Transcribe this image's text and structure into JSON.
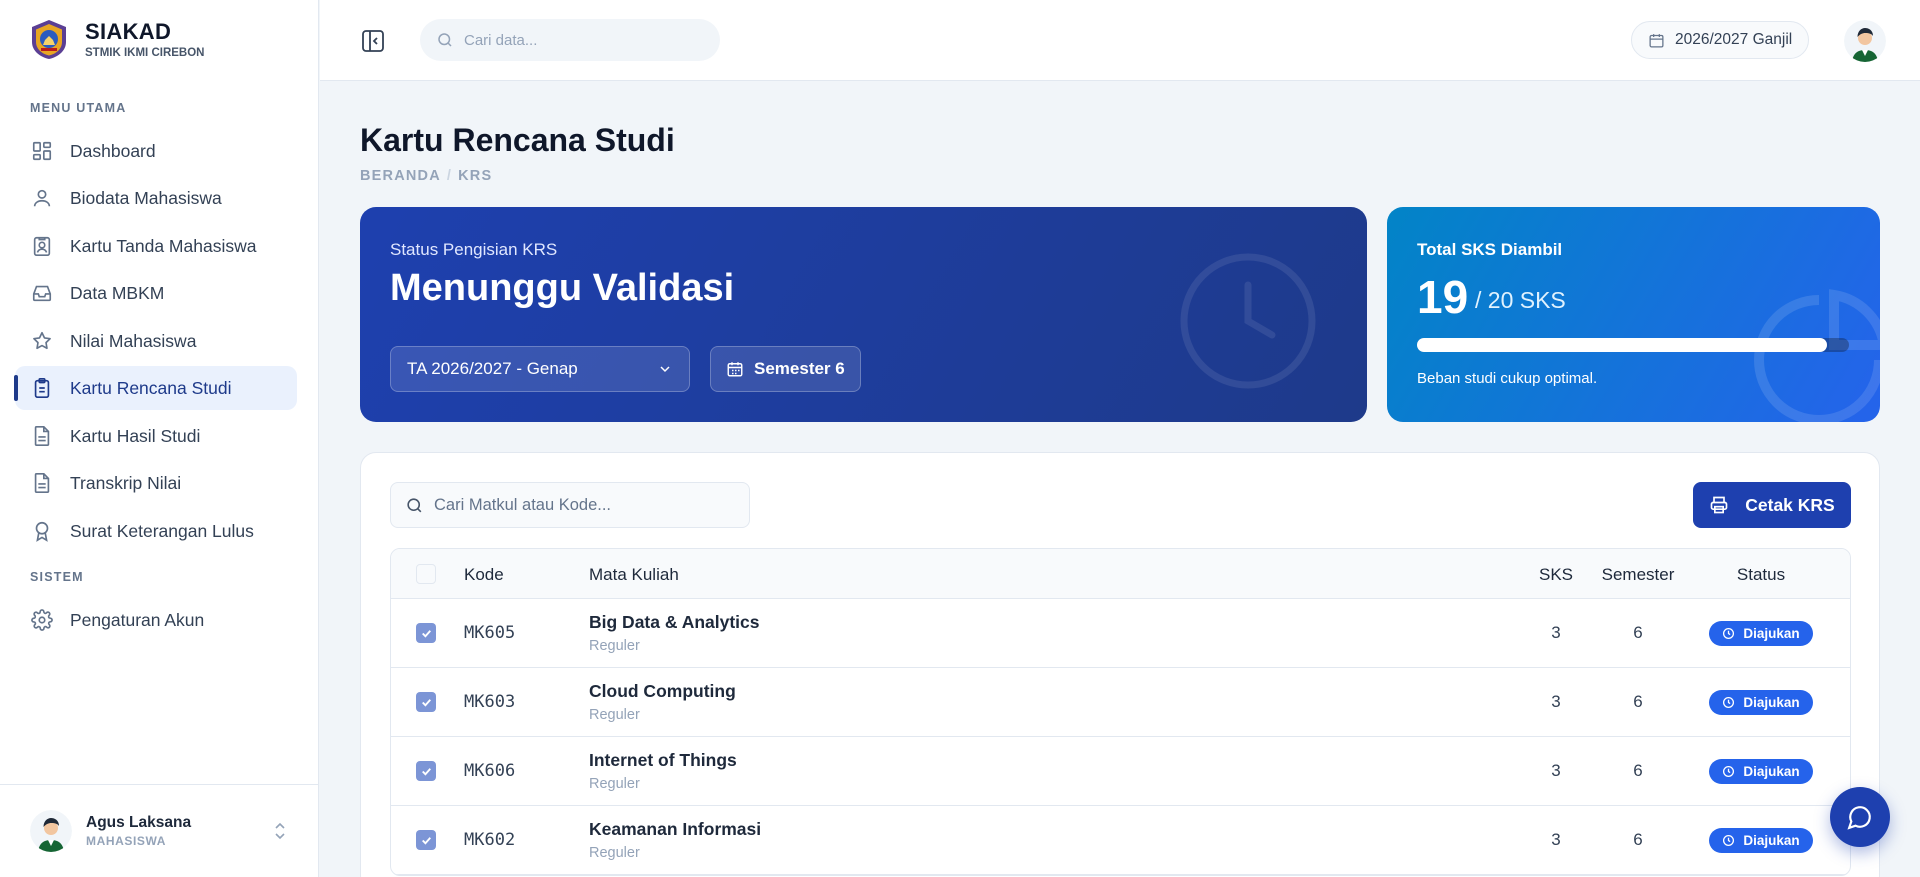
{
  "brand": {
    "title": "SIAKAD",
    "subtitle": "STMIK IKMI CIREBON"
  },
  "sidebar": {
    "menu_label": "MENU UTAMA",
    "items": [
      {
        "label": "Dashboard",
        "icon": "dashboard-icon"
      },
      {
        "label": "Biodata Mahasiswa",
        "icon": "user-icon"
      },
      {
        "label": "Kartu Tanda Mahasiswa",
        "icon": "id-card-icon"
      },
      {
        "label": "Data MBKM",
        "icon": "inbox-icon"
      },
      {
        "label": "Nilai Mahasiswa",
        "icon": "star-icon"
      },
      {
        "label": "Kartu Rencana Studi",
        "icon": "clipboard-icon",
        "active": true
      },
      {
        "label": "Kartu Hasil Studi",
        "icon": "document-icon"
      },
      {
        "label": "Transkrip Nilai",
        "icon": "document-icon"
      },
      {
        "label": "Surat Keterangan Lulus",
        "icon": "award-icon"
      }
    ],
    "system_label": "SISTEM",
    "system_items": [
      {
        "label": "Pengaturan Akun",
        "icon": "gear-icon"
      }
    ]
  },
  "user": {
    "name": "Agus Laksana",
    "role": "MAHASISWA"
  },
  "topbar": {
    "search_placeholder": "Cari data...",
    "period": "2026/2027 Ganjil"
  },
  "page": {
    "title": "Kartu Rencana Studi",
    "breadcrumb": [
      "BERANDA",
      "KRS"
    ]
  },
  "status_card": {
    "label": "Status Pengisian KRS",
    "value": "Menunggu Validasi",
    "academic_year": "TA 2026/2027 - Genap",
    "semester": "Semester 6"
  },
  "sks_card": {
    "label": "Total SKS Diambil",
    "taken": "19",
    "max_text": "/ 20 SKS",
    "progress": 0.95,
    "note": "Beban studi cukup optimal."
  },
  "table": {
    "search_placeholder": "Cari Matkul atau Kode...",
    "print_label": "Cetak KRS",
    "headers": {
      "code": "Kode",
      "course": "Mata Kuliah",
      "sks": "SKS",
      "semester": "Semester",
      "status": "Status"
    },
    "rows": [
      {
        "code": "MK605",
        "name": "Big Data & Analytics",
        "type": "Reguler",
        "sks": "3",
        "semester": "6",
        "status": "Diajukan"
      },
      {
        "code": "MK603",
        "name": "Cloud Computing",
        "type": "Reguler",
        "sks": "3",
        "semester": "6",
        "status": "Diajukan"
      },
      {
        "code": "MK606",
        "name": "Internet of Things",
        "type": "Reguler",
        "sks": "3",
        "semester": "6",
        "status": "Diajukan"
      },
      {
        "code": "MK602",
        "name": "Keamanan Informasi",
        "type": "Reguler",
        "sks": "3",
        "semester": "6",
        "status": "Diajukan"
      }
    ]
  },
  "colors": {
    "primary": "#1e40af",
    "accent": "#2563eb",
    "sidebar_active_bg": "#eaf1fd"
  }
}
